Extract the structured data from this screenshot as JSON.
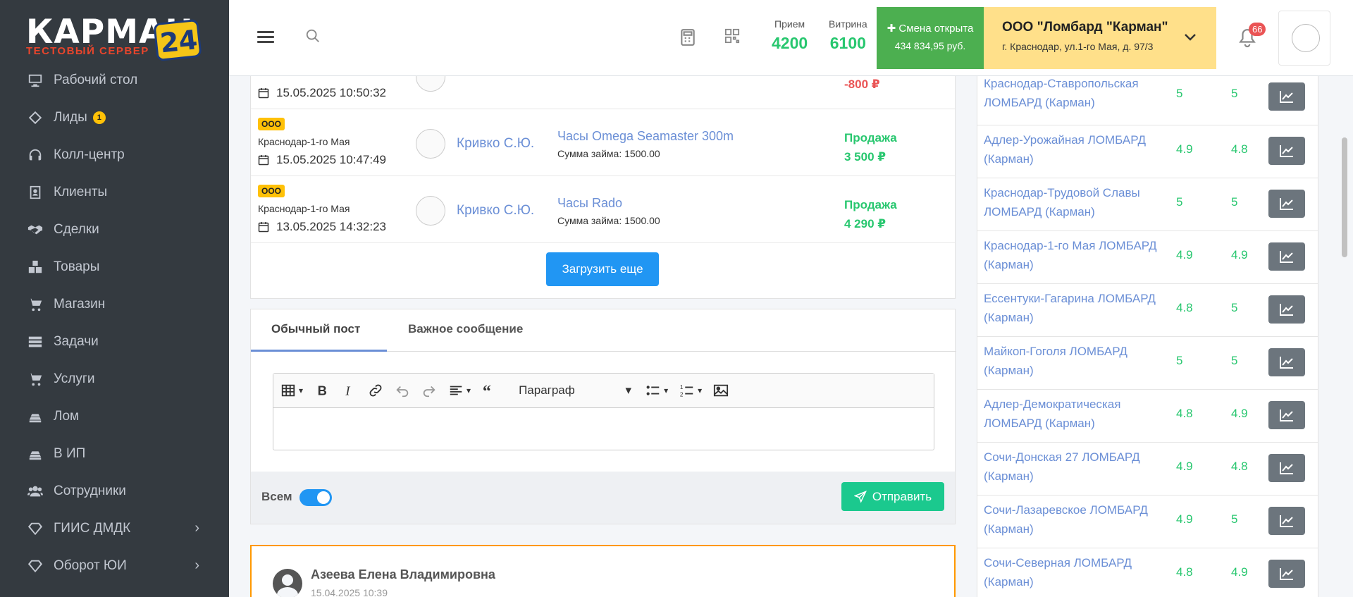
{
  "logo": {
    "word": "КАРМАН",
    "number": "24",
    "subtitle": "ТЕСТОВЫЙ СЕРВЕР"
  },
  "sidebar": {
    "items": [
      {
        "label": "Рабочий стол",
        "icon": "desktop-icon"
      },
      {
        "label": "Лиды",
        "icon": "tag-icon",
        "count": "1"
      },
      {
        "label": "Колл-центр",
        "icon": "headset-icon"
      },
      {
        "label": "Клиенты",
        "icon": "id-card-icon"
      },
      {
        "label": "Сделки",
        "icon": "handshake-icon"
      },
      {
        "label": "Товары",
        "icon": "boxes-icon"
      },
      {
        "label": "Магазин",
        "icon": "cart-icon"
      },
      {
        "label": "Задачи",
        "icon": "tasks-icon"
      },
      {
        "label": "Услуги",
        "icon": "cart-icon"
      },
      {
        "label": "Лом",
        "icon": "gold-bars-icon"
      },
      {
        "label": "В ИП",
        "icon": "gold-bars-icon"
      },
      {
        "label": "Сотрудники",
        "icon": "users-icon"
      },
      {
        "label": "ГИИС ДМДК",
        "icon": "gem-icon",
        "expandable": true
      },
      {
        "label": "Оборот ЮИ",
        "icon": "gem-icon",
        "expandable": true
      }
    ]
  },
  "header": {
    "stats": [
      {
        "label": "Прием",
        "value": "4200"
      },
      {
        "label": "Витрина",
        "value": "6100"
      }
    ],
    "shift": {
      "title": "Смена открыта",
      "amount": "434 834,95 руб."
    },
    "org": {
      "name": "ООО \"Ломбард \"Карман\"",
      "address": "г. Краснодар, ул.1-го Мая, д. 97/3"
    },
    "notifications": "66"
  },
  "feed": {
    "partial_row": {
      "datetime": "15.05.2025 10:50:32",
      "amount": "-800 ₽"
    },
    "rows": [
      {
        "tag": "ООО",
        "branch": "Краснодар-1-го Мая",
        "datetime": "15.05.2025 10:47:49",
        "employee": "Кривко С.Ю.",
        "item": "Часы Omega Seamaster 300m",
        "loan": "Сумма займа: 1500.00",
        "op": "Продажа",
        "amount": "3 500 ₽"
      },
      {
        "tag": "ООО",
        "branch": "Краснодар-1-го Мая",
        "datetime": "13.05.2025 14:32:23",
        "employee": "Кривко С.Ю.",
        "item": "Часы Rado",
        "loan": "Сумма займа: 1500.00",
        "op": "Продажа",
        "amount": "4 290 ₽"
      }
    ],
    "load_more": "Загрузить еще"
  },
  "post": {
    "tabs": [
      "Обычный пост",
      "Важное сообщение"
    ],
    "paragraph": "Параграф",
    "all_label": "Всем",
    "send_label": "Отправить"
  },
  "message": {
    "author": "Азеева Елена Владимировна",
    "time": "15.04.2025 10:39"
  },
  "ratings": [
    {
      "name": "Краснодар-Ставропольская ЛОМБАРД (Карман)",
      "r1": "5",
      "r2": "5"
    },
    {
      "name": "Адлер-Урожайная ЛОМБАРД (Карман)",
      "r1": "4.9",
      "r2": "4.8"
    },
    {
      "name": "Краснодар-Трудовой Славы ЛОМБАРД (Карман)",
      "r1": "5",
      "r2": "5"
    },
    {
      "name": "Краснодар-1-го Мая ЛОМБАРД (Карман)",
      "r1": "4.9",
      "r2": "4.9"
    },
    {
      "name": "Ессентуки-Гагарина ЛОМБАРД (Карман)",
      "r1": "4.8",
      "r2": "5"
    },
    {
      "name": "Майкоп-Гоголя ЛОМБАРД (Карман)",
      "r1": "5",
      "r2": "5"
    },
    {
      "name": "Адлер-Демократическая ЛОМБАРД (Карман)",
      "r1": "4.8",
      "r2": "4.9"
    },
    {
      "name": "Сочи-Донская 27 ЛОМБАРД (Карман)",
      "r1": "4.9",
      "r2": "4.8"
    },
    {
      "name": "Сочи-Лазаревское ЛОМБАРД (Карман)",
      "r1": "4.9",
      "r2": "5"
    },
    {
      "name": "Сочи-Северная ЛОМБАРД (Карман)",
      "r1": "4.8",
      "r2": "4.9"
    }
  ],
  "colors": {
    "sidebar": "#343a40",
    "accent_green": "#28c76f",
    "link": "#6b8fd6",
    "org_bg": "#ffe08a",
    "shift_bg": "#4caf50"
  }
}
